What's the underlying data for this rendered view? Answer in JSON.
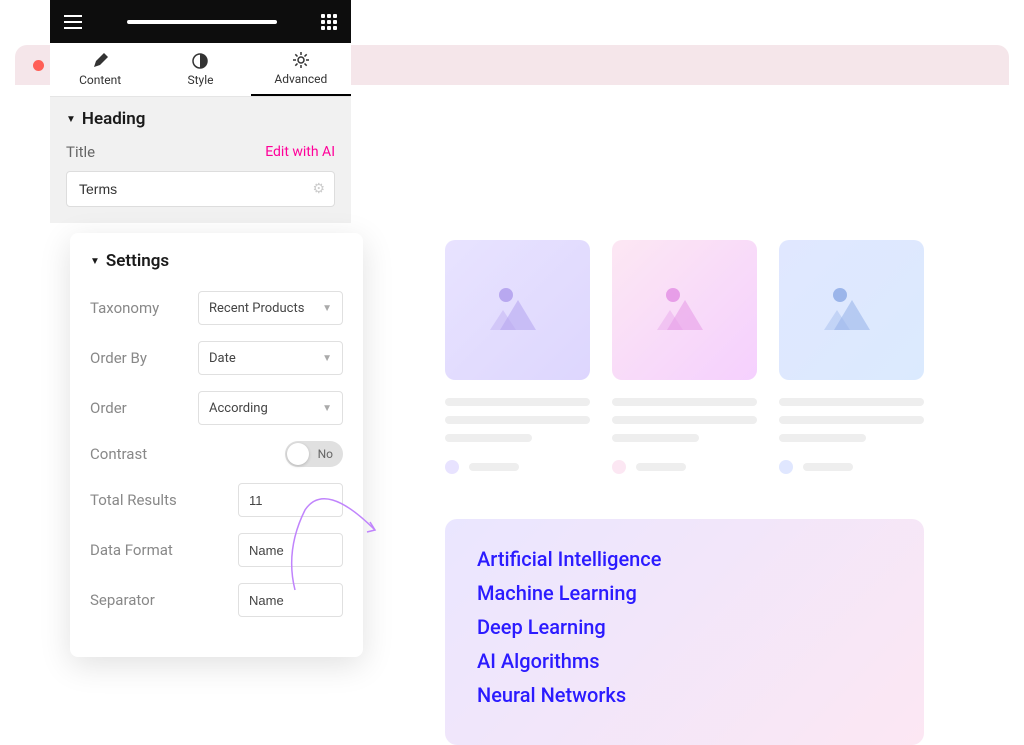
{
  "tabs": {
    "content": "Content",
    "style": "Style",
    "advanced": "Advanced"
  },
  "heading": {
    "section": "Heading",
    "title_label": "Title",
    "edit_ai": "Edit with AI",
    "title_value": "Terms"
  },
  "settings": {
    "header": "Settings",
    "taxonomy_label": "Taxonomy",
    "taxonomy_value": "Recent Products",
    "orderby_label": "Order By",
    "orderby_value": "Date",
    "order_label": "Order",
    "order_value": "According",
    "contrast_label": "Contrast",
    "contrast_value": "No",
    "total_label": "Total Results",
    "total_value": "11",
    "format_label": "Data Format",
    "format_value": "Name",
    "separator_label": "Separator",
    "separator_value": "Name"
  },
  "terms": [
    "Artificial Intelligence",
    "Machine Learning",
    "Deep Learning",
    "AI Algorithms",
    "Neural Networks"
  ]
}
